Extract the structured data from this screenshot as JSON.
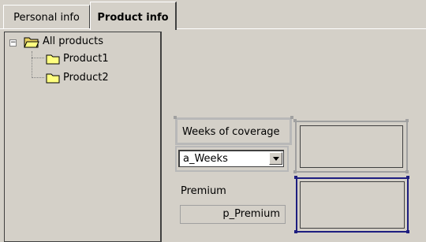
{
  "tabs": {
    "personal": "Personal info",
    "product": "Product info"
  },
  "tree": {
    "root": "All products",
    "children": [
      "Product1",
      "Product2"
    ],
    "expander": "−"
  },
  "form": {
    "weeks_label": "Weeks of coverage",
    "weeks_value": "a_Weeks",
    "premium_label": "Premium",
    "premium_value": "p_Premium"
  },
  "colors": {
    "background": "#d4d0c8",
    "selection_border": "#1e1e80"
  },
  "icons": [
    "folder-open-icon",
    "folder-icon",
    "chevron-down-icon"
  ]
}
